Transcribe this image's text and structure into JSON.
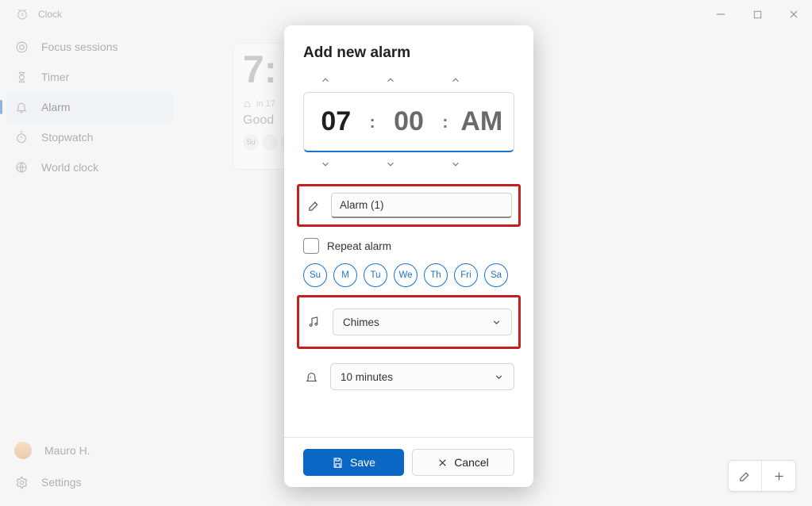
{
  "titlebar": {
    "title": "Clock"
  },
  "sidebar": {
    "items": [
      {
        "label": "Focus sessions",
        "icon": "focus-icon",
        "active": false
      },
      {
        "label": "Timer",
        "icon": "hourglass-icon",
        "active": false
      },
      {
        "label": "Alarm",
        "icon": "bell-icon",
        "active": true
      },
      {
        "label": "Stopwatch",
        "icon": "stopwatch-icon",
        "active": false
      },
      {
        "label": "World clock",
        "icon": "globe-icon",
        "active": false
      }
    ],
    "account": {
      "name": "Mauro H."
    },
    "settings_label": "Settings"
  },
  "background_card": {
    "time_partial": "7:",
    "in_label": "in 17",
    "subtitle_partial": "Good",
    "day_chip_visible": "Su"
  },
  "modal": {
    "title": "Add new alarm",
    "time": {
      "hour": "07",
      "minute": "00",
      "ampm": "AM"
    },
    "name_field": {
      "value": "Alarm (1)"
    },
    "repeat": {
      "label": "Repeat alarm",
      "checked": false,
      "days": [
        "Su",
        "M",
        "Tu",
        "We",
        "Th",
        "Fri",
        "Sa"
      ]
    },
    "sound": {
      "value": "Chimes"
    },
    "snooze": {
      "value": "10 minutes"
    },
    "actions": {
      "save": "Save",
      "cancel": "Cancel"
    }
  }
}
